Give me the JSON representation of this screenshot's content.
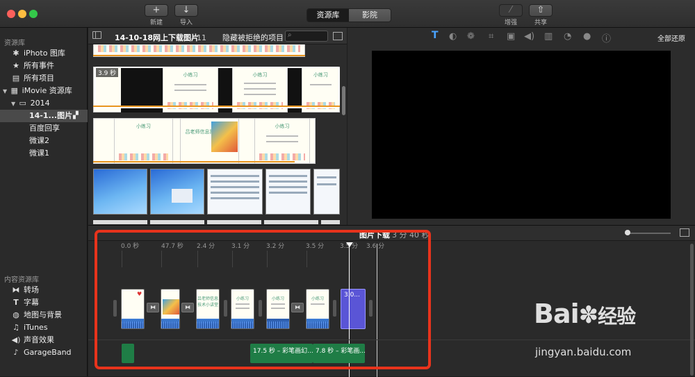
{
  "toolbar": {
    "new_label": "新建",
    "import_label": "导入",
    "tabs": [
      "资源库",
      "影院"
    ],
    "enhance_label": "增强",
    "share_label": "共享",
    "icons": {
      "new": "plus-icon",
      "import": "download-arrow-icon",
      "enhance": "magic-wand-icon",
      "share": "share-icon"
    }
  },
  "sidebar": {
    "library_header": "资源库",
    "items": [
      {
        "label": "iPhoto 图库",
        "icon": "camera-icon",
        "glyph": "✱"
      },
      {
        "label": "所有事件",
        "icon": "star-icon",
        "glyph": "★"
      },
      {
        "label": "所有项目",
        "icon": "film-icon",
        "glyph": "▤"
      },
      {
        "label": "iMovie 资源库",
        "icon": "grid-icon",
        "glyph": "▦"
      },
      {
        "label": "2014",
        "icon": "folder-icon",
        "glyph": "▭"
      },
      {
        "label": "14-1...图片",
        "icon": "clapper-icon",
        "glyph": "🎬"
      },
      {
        "label": "百度回享",
        "icon": "",
        "glyph": ""
      },
      {
        "label": "微课2",
        "icon": "",
        "glyph": ""
      },
      {
        "label": "微课1",
        "icon": "",
        "glyph": ""
      }
    ],
    "content_header": "内容资源库",
    "content_items": [
      {
        "label": "转场",
        "icon": "transition-icon",
        "glyph": "⧓"
      },
      {
        "label": "字幕",
        "icon": "title-t-icon",
        "glyph": "T"
      },
      {
        "label": "地图与背景",
        "icon": "globe-icon",
        "glyph": "◍"
      },
      {
        "label": "iTunes",
        "icon": "music-note-icon",
        "glyph": "♫"
      },
      {
        "label": "声音效果",
        "icon": "speaker-icon",
        "glyph": "◀)"
      },
      {
        "label": "GarageBand",
        "icon": "guitar-icon",
        "glyph": "♪"
      }
    ]
  },
  "browser": {
    "event_title": "14-10-18网上下载图片",
    "page_count": "1／11",
    "filter_label": "隐藏被拒绝的项目 ≎",
    "search_placeholder": "",
    "selected_clip_duration": "3.9 秒",
    "slide_title": "小练习",
    "slide_title2": "吕老师信息技术小讲堂"
  },
  "viewer": {
    "reset_all_label": "全部还原",
    "tool_icons": [
      "title-icon",
      "color-balance-icon",
      "color-palette-icon",
      "crop-icon",
      "camera-stabilize-icon",
      "volume-icon",
      "noise-eq-icon",
      "speed-icon",
      "filter-icon",
      "info-icon"
    ]
  },
  "timeline": {
    "project_title": "图片下载",
    "project_duration": "3 分 40 秒",
    "ruler": [
      "0.0 秒",
      "47.7 秒",
      "2.4 分",
      "3.1 分",
      "3.2 分",
      "3.5 分",
      "3.5 分",
      "3.6 分"
    ],
    "selected_clip_label": "3.0...",
    "audio_clips": [
      {
        "label": "17.5 秒 – 彩笔画幻..."
      },
      {
        "label": "7.8 秒 – 彩笔画..."
      }
    ]
  },
  "watermark": {
    "brand": "Bai",
    "brand_cn": "经验",
    "url": "jingyan.baidu.com"
  },
  "colors": {
    "accent_orange": "#e8951f",
    "highlight_red": "#e8331c",
    "selected_clip": "#5a55d6",
    "audio_green": "#1f7d46"
  }
}
